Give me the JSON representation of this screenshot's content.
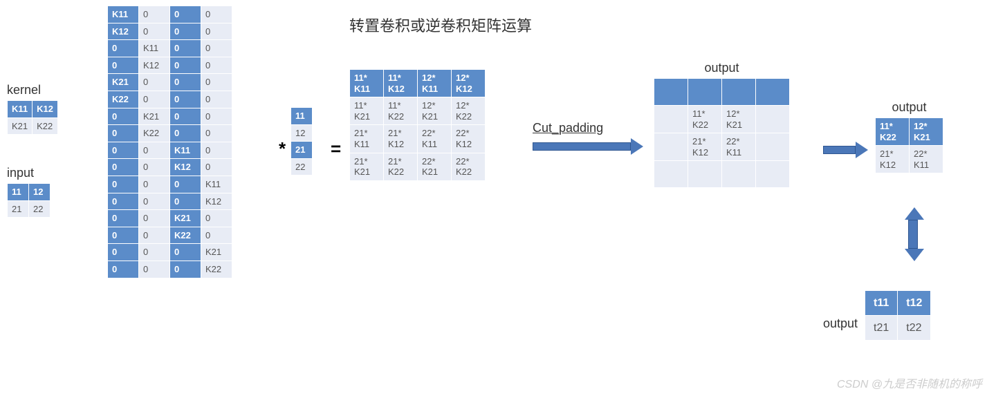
{
  "title": "转置卷积或逆卷积矩阵运算",
  "labels": {
    "kernel": "kernel",
    "input": "input",
    "output": "output",
    "cut_padding": "Cut_padding"
  },
  "ops": {
    "mul": "*",
    "eq": "="
  },
  "kernel": [
    [
      "K11",
      "K12"
    ],
    [
      "K21",
      "K22"
    ]
  ],
  "input": [
    [
      "11",
      "12"
    ],
    [
      "21",
      "22"
    ]
  ],
  "bigmat": [
    [
      "K11",
      "0",
      "0",
      "0"
    ],
    [
      "K12",
      "0",
      "0",
      "0"
    ],
    [
      "0",
      "K11",
      "0",
      "0"
    ],
    [
      "0",
      "K12",
      "0",
      "0"
    ],
    [
      "K21",
      "0",
      "0",
      "0"
    ],
    [
      "K22",
      "0",
      "0",
      "0"
    ],
    [
      "0",
      "K21",
      "0",
      "0"
    ],
    [
      "0",
      "K22",
      "0",
      "0"
    ],
    [
      "0",
      "0",
      "K11",
      "0"
    ],
    [
      "0",
      "0",
      "K12",
      "0"
    ],
    [
      "0",
      "0",
      "0",
      "K11"
    ],
    [
      "0",
      "0",
      "0",
      "K12"
    ],
    [
      "0",
      "0",
      "K21",
      "0"
    ],
    [
      "0",
      "0",
      "K22",
      "0"
    ],
    [
      "0",
      "0",
      "0",
      "K21"
    ],
    [
      "0",
      "0",
      "0",
      "K22"
    ]
  ],
  "vec": [
    "11",
    "12",
    "21",
    "22"
  ],
  "result4": [
    [
      "11*\nK11",
      "11*\nK12",
      "12*\nK11",
      "12*\nK12"
    ],
    [
      "11*\nK21",
      "11*\nK22",
      "12*\nK21",
      "12*\nK22"
    ],
    [
      "21*\nK11",
      "21*\nK12",
      "22*\nK11",
      "22*\nK12"
    ],
    [
      "21*\nK21",
      "21*\nK22",
      "22*\nK21",
      "22*\nK22"
    ]
  ],
  "out4": [
    [
      "",
      "",
      "",
      ""
    ],
    [
      "",
      "11*\nK22",
      "12*\nK21",
      ""
    ],
    [
      "",
      "21*\nK12",
      "22*\nK11",
      ""
    ],
    [
      "",
      "",
      "",
      ""
    ]
  ],
  "out2a": [
    [
      "11*\nK22",
      "12*\nK21"
    ],
    [
      "21*\nK12",
      "22*\nK11"
    ]
  ],
  "out2b": [
    [
      "t11",
      "t12"
    ],
    [
      "t21",
      "t22"
    ]
  ],
  "watermark": "CSDN @九是否非随机的称呼"
}
